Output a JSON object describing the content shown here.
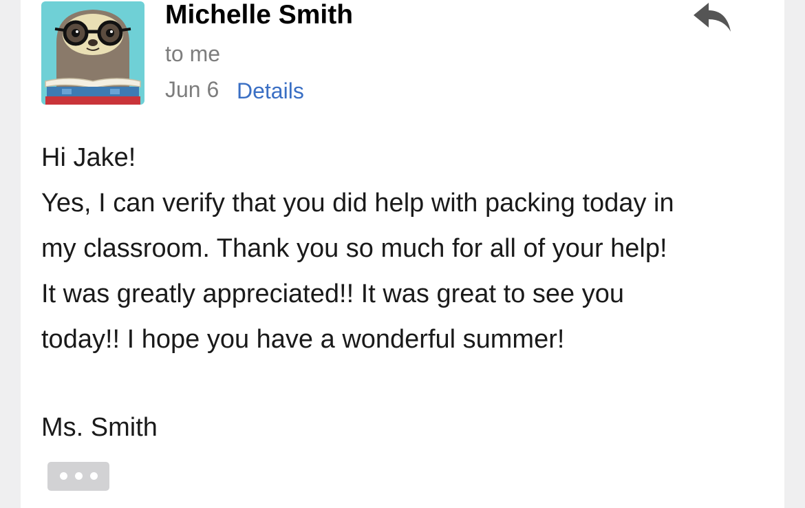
{
  "message": {
    "sender_name": "Michelle Smith",
    "recipient_line": "to me",
    "date": "Jun 6",
    "details_label": "Details",
    "avatar_icon": "sloth-reading-avatar",
    "reply_icon": "reply-arrow-icon",
    "body_lines": [
      "Hi Jake!",
      "Yes, I can verify that you did help with packing today in",
      "my classroom.  Thank you so much for all of your help!",
      "It was greatly appreciated!!  It was great to see you",
      "today!!  I hope you have a wonderful summer!"
    ],
    "signature": "Ms. Smith",
    "more_icon": "ellipsis-icon"
  },
  "colors": {
    "background": "#efeff0",
    "card": "#ffffff",
    "link": "#3a6fc4",
    "secondary_text": "#7d7d7d",
    "reply_icon": "#555555",
    "more_button": "#d2d2d4"
  }
}
